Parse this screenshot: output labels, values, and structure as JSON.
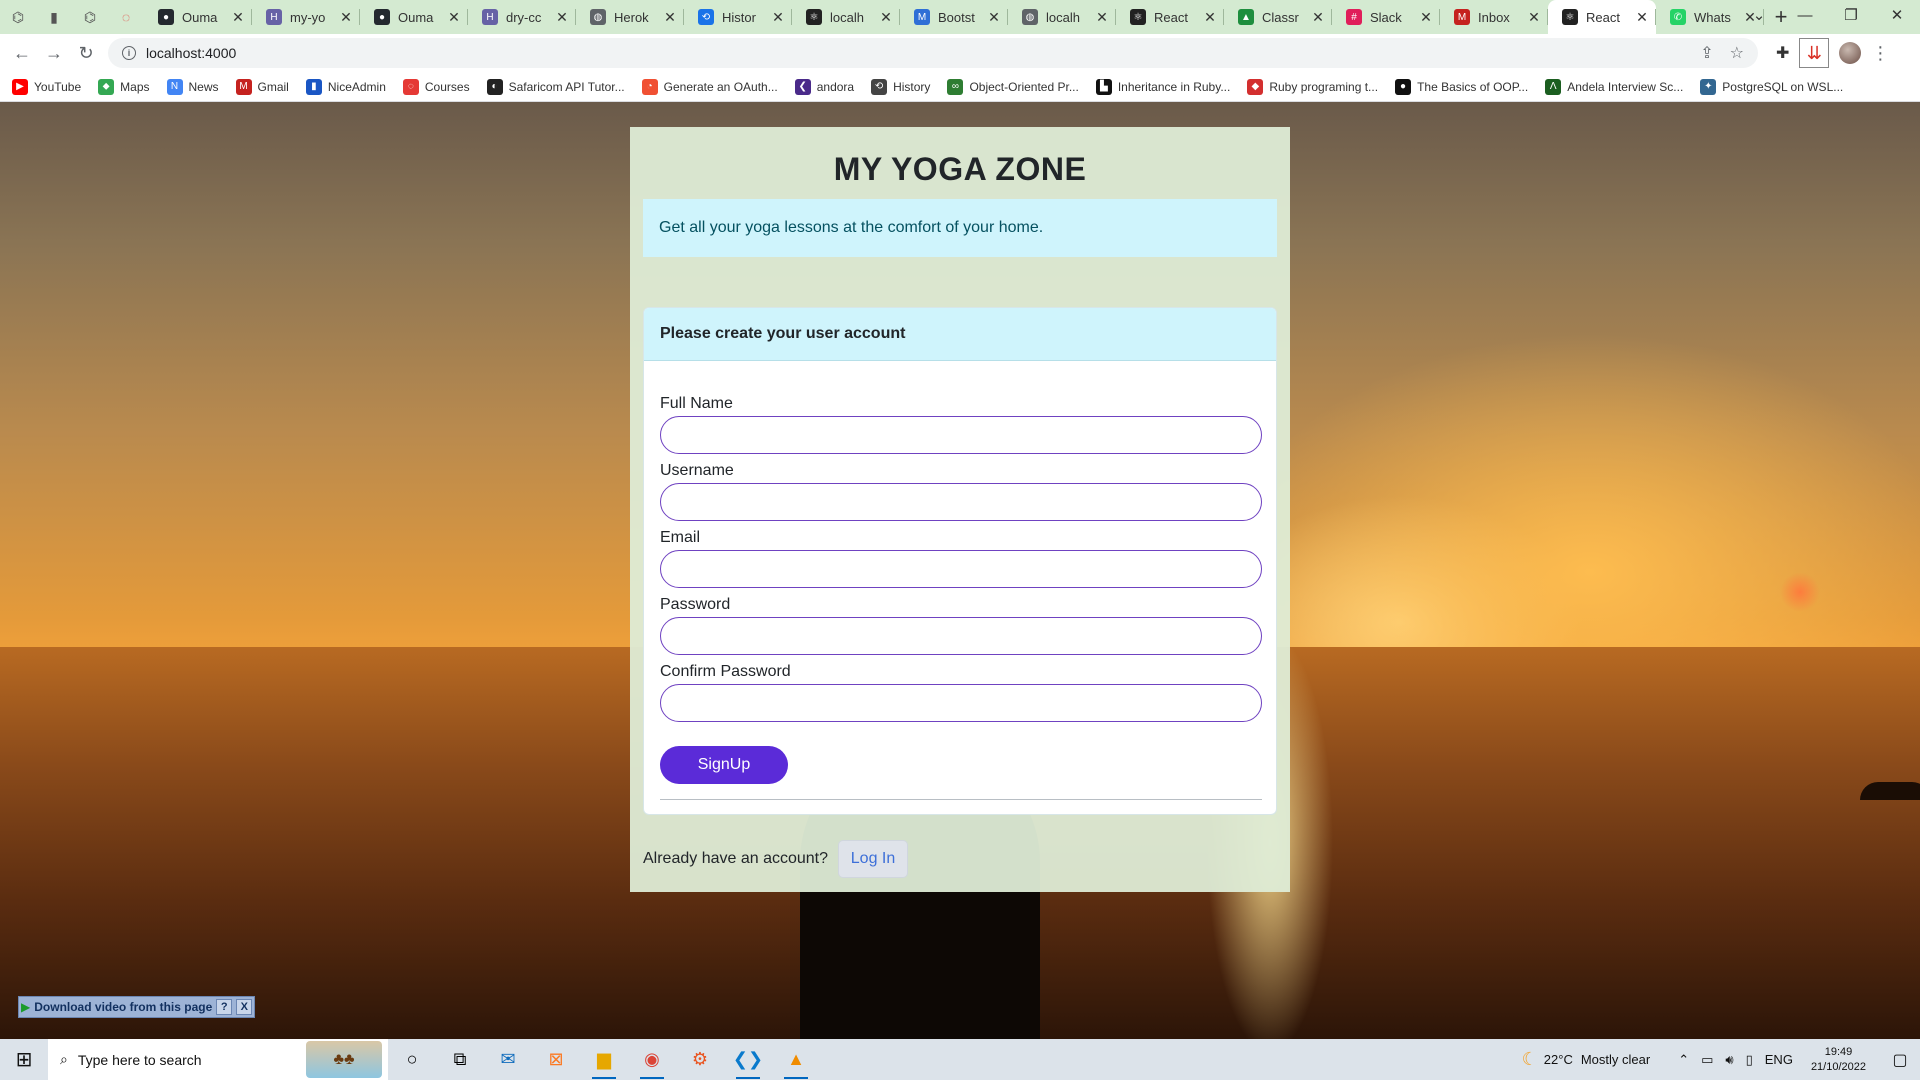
{
  "browser": {
    "tabs": [
      {
        "title": "",
        "icon": "gitpod-icon",
        "color": "#555555",
        "pinned": true
      },
      {
        "title": "",
        "icon": "nice-admin-icon",
        "color": "#555555",
        "pinned": true
      },
      {
        "title": "",
        "icon": "gitpod-icon",
        "color": "#555555",
        "pinned": true
      },
      {
        "title": "",
        "icon": "courses-icon",
        "color": "#e53935",
        "pinned": true
      },
      {
        "title": "Ouma",
        "icon": "github-icon",
        "color": "#24292f"
      },
      {
        "title": "my-yo",
        "icon": "heroku-icon",
        "color": "#6762a6"
      },
      {
        "title": "Ouma",
        "icon": "github-icon",
        "color": "#24292f"
      },
      {
        "title": "dry-cc",
        "icon": "heroku-icon",
        "color": "#6762a6"
      },
      {
        "title": "Herok",
        "icon": "globe-icon",
        "color": "#5f6368"
      },
      {
        "title": "Histor",
        "icon": "history-icon",
        "color": "#1a73e8"
      },
      {
        "title": "localh",
        "icon": "react-icon",
        "color": "#222222"
      },
      {
        "title": "Bootst",
        "icon": "msb-icon",
        "color": "#2f6fd6"
      },
      {
        "title": "localh",
        "icon": "globe-icon",
        "color": "#5f6368"
      },
      {
        "title": "React",
        "icon": "react-icon",
        "color": "#222222"
      },
      {
        "title": "Classr",
        "icon": "classroom-icon",
        "color": "#1e8e3e"
      },
      {
        "title": "Slack",
        "icon": "slack-icon",
        "color": "#e01e5a"
      },
      {
        "title": "Inbox",
        "icon": "gmail-icon",
        "color": "#c5221f"
      },
      {
        "title": "React",
        "icon": "react-icon",
        "color": "#222222",
        "active": true
      },
      {
        "title": "Whats",
        "icon": "whatsapp-icon",
        "color": "#25d366"
      }
    ],
    "url": "localhost:4000",
    "bookmarks": [
      {
        "label": "YouTube",
        "icon": "youtube-icon",
        "color": "#ff0000"
      },
      {
        "label": "Maps",
        "icon": "maps-icon",
        "color": "#34a853"
      },
      {
        "label": "News",
        "icon": "news-icon",
        "color": "#4285f4"
      },
      {
        "label": "Gmail",
        "icon": "gmail-icon",
        "color": "#c5221f"
      },
      {
        "label": "NiceAdmin",
        "icon": "nice-admin-icon",
        "color": "#1a56c4"
      },
      {
        "label": "Courses",
        "icon": "courses-icon",
        "color": "#e53935"
      },
      {
        "label": "Safaricom API Tutor...",
        "icon": "safaricom-icon",
        "color": "#222222"
      },
      {
        "label": "Generate an OAuth...",
        "icon": "oauth-icon",
        "color": "#f05033"
      },
      {
        "label": "andora",
        "icon": "andora-icon",
        "color": "#4a2a8a"
      },
      {
        "label": "History",
        "icon": "history-icon",
        "color": "#444444"
      },
      {
        "label": "Object-Oriented Pr...",
        "icon": "oop-icon",
        "color": "#2e7d32"
      },
      {
        "label": "Inheritance in Ruby...",
        "icon": "ruby-doc-icon",
        "color": "#111111"
      },
      {
        "label": "Ruby programing t...",
        "icon": "ruby-icon",
        "color": "#d32f2f"
      },
      {
        "label": "The Basics of OOP...",
        "icon": "medium-icon",
        "color": "#111111"
      },
      {
        "label": "Andela Interview Sc...",
        "icon": "andela-icon",
        "color": "#1b5e20"
      },
      {
        "label": "PostgreSQL on WSL...",
        "icon": "postgres-icon",
        "color": "#336791"
      }
    ]
  },
  "page": {
    "title": "MY YOGA ZONE",
    "tagline": "Get all your yoga lessons at the comfort of your home.",
    "form": {
      "header": "Please create your user account",
      "fields": [
        {
          "label": "Full Name",
          "value": ""
        },
        {
          "label": "Username",
          "value": ""
        },
        {
          "label": "Email",
          "value": ""
        },
        {
          "label": "Password",
          "value": ""
        },
        {
          "label": "Confirm Password",
          "value": ""
        }
      ],
      "submit_label": "SignUp"
    },
    "login": {
      "question": "Already have an account?",
      "button_label": "Log In"
    },
    "download_bar": {
      "label": "Download video from this page",
      "help": "?",
      "close": "X"
    }
  },
  "taskbar": {
    "search_placeholder": "Type here to search",
    "weather": {
      "temp": "22°C",
      "condition": "Mostly clear"
    },
    "language": "ENG",
    "time": "19:49",
    "date": "21/10/2022"
  },
  "colors": {
    "primary": "#5b2bd8",
    "input_border": "#6f42c1",
    "info_bg": "#cff4fc",
    "tab_strip": "#d4ead1"
  }
}
